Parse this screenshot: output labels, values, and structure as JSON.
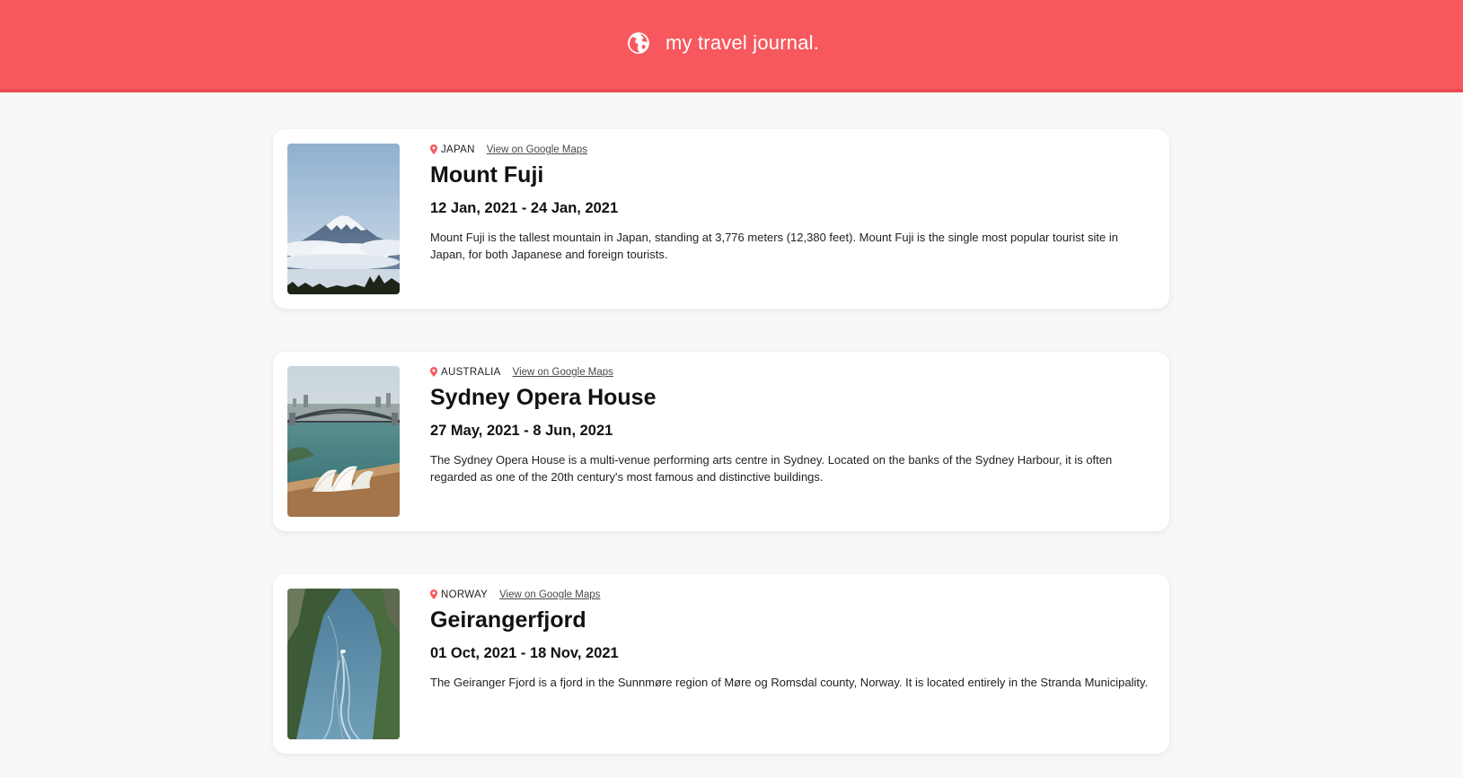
{
  "app": {
    "title": "my travel journal.",
    "header_color": "#f7585e",
    "icon": "globe-icon"
  },
  "entries": [
    {
      "country": "JAPAN",
      "maps_link": "View on Google Maps",
      "title": "Mount Fuji",
      "dates": "12 Jan, 2021 - 24 Jan, 2021",
      "description": "Mount Fuji is the tallest mountain in Japan, standing at 3,776 meters (12,380 feet). Mount Fuji is the single most popular tourist site in Japan, for both Japanese and foreign tourists.",
      "image": "mount-fuji-photo"
    },
    {
      "country": "AUSTRALIA",
      "maps_link": "View on Google Maps",
      "title": "Sydney Opera House",
      "dates": "27 May, 2021 - 8 Jun, 2021",
      "description": "The Sydney Opera House is a multi-venue performing arts centre in Sydney. Located on the banks of the Sydney Harbour, it is often regarded as one of the 20th century's most famous and distinctive buildings.",
      "image": "sydney-opera-house-photo"
    },
    {
      "country": "NORWAY",
      "maps_link": "View on Google Maps",
      "title": "Geirangerfjord",
      "dates": "01 Oct, 2021 - 18 Nov, 2021",
      "description": "The Geiranger Fjord is a fjord in the Sunnmøre region of Møre og Romsdal county, Norway. It is located entirely in the Stranda Municipality.",
      "image": "geirangerfjord-photo"
    }
  ],
  "colors": {
    "accent": "#f7585e",
    "pin": "#f7585e",
    "background": "#f8f8f8"
  }
}
